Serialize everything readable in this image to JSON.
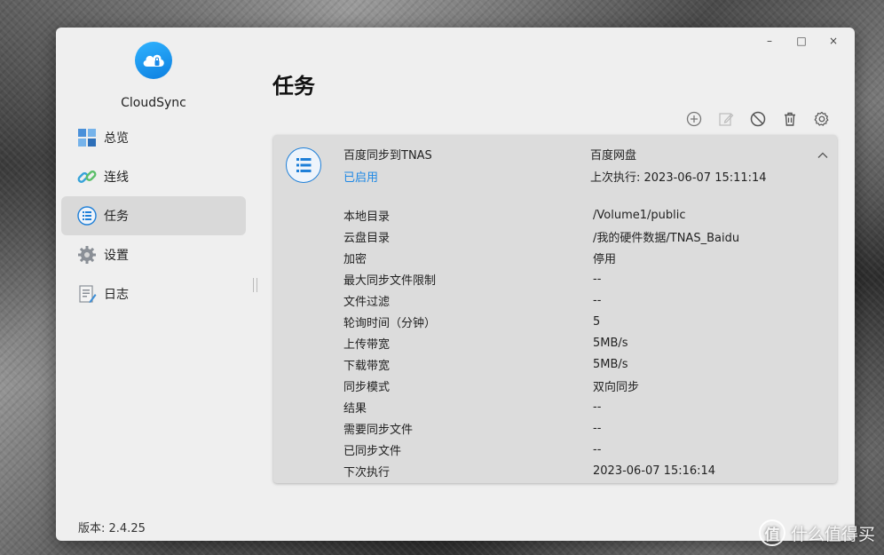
{
  "app": {
    "name": "CloudSync",
    "version_label": "版本: 2.4.25"
  },
  "window_controls": {
    "minimize": "–",
    "maximize": "□",
    "close": "×"
  },
  "sidebar": {
    "items": [
      {
        "label": "总览",
        "icon": "overview-grid-icon",
        "active": false
      },
      {
        "label": "连线",
        "icon": "link-icon",
        "active": false
      },
      {
        "label": "任务",
        "icon": "task-list-icon",
        "active": true
      },
      {
        "label": "设置",
        "icon": "gear-icon",
        "active": false
      },
      {
        "label": "日志",
        "icon": "log-document-icon",
        "active": false
      }
    ]
  },
  "main": {
    "title": "任务",
    "toolbar": [
      "add-icon",
      "edit-icon",
      "disable-icon",
      "delete-icon",
      "settings-icon"
    ]
  },
  "task": {
    "name": "百度同步到TNAS",
    "status": "已启用",
    "provider": "百度网盘",
    "last_run": "上次执行: 2023-06-07 15:11:14",
    "details": [
      {
        "label": "本地目录",
        "value": "/Volume1/public"
      },
      {
        "label": "云盘目录",
        "value": "/我的硬件数据/TNAS_Baidu"
      },
      {
        "label": "加密",
        "value": "停用"
      },
      {
        "label": "最大同步文件限制",
        "value": "--"
      },
      {
        "label": "文件过滤",
        "value": "--"
      },
      {
        "label": "轮询时间（分钟）",
        "value": "5"
      },
      {
        "label": "上传带宽",
        "value": "5MB/s"
      },
      {
        "label": "下载带宽",
        "value": "5MB/s"
      },
      {
        "label": "同步模式",
        "value": "双向同步"
      },
      {
        "label": "结果",
        "value": "--"
      },
      {
        "label": "需要同步文件",
        "value": "--"
      },
      {
        "label": "已同步文件",
        "value": "--"
      },
      {
        "label": "下次执行",
        "value": "2023-06-07 15:16:14"
      }
    ]
  },
  "watermark": {
    "mark": "值",
    "text": "什么值得买"
  },
  "colors": {
    "accent": "#1e88e5",
    "active_nav": "#d9d9d9",
    "card_bg": "#dcdcdc",
    "window_bg": "#efefef"
  }
}
